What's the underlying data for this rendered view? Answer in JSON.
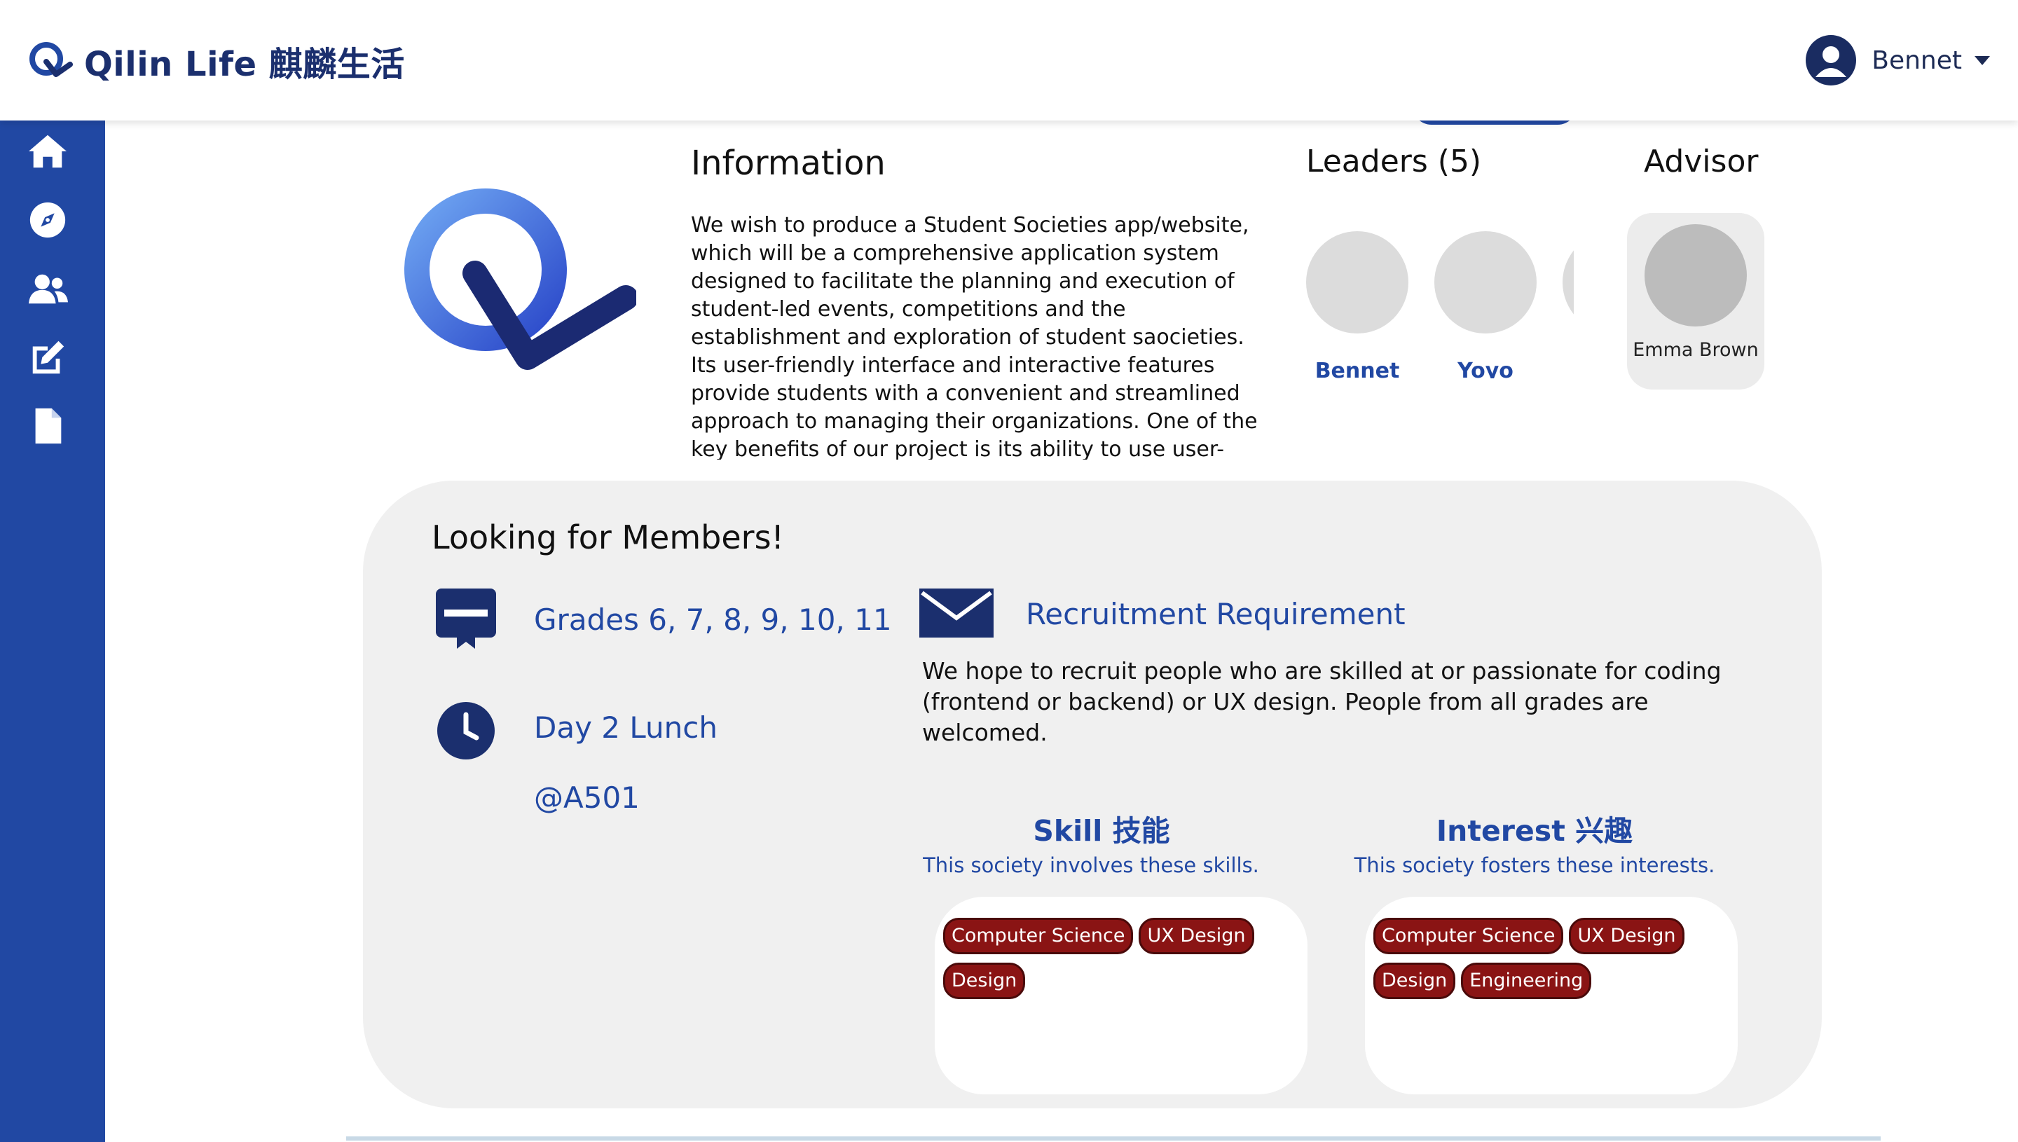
{
  "header": {
    "brand": "Qilin Life 麒麟生活",
    "user_name": "Bennet"
  },
  "sidebar": {
    "items": [
      {
        "icon": "home-icon"
      },
      {
        "icon": "compass-icon"
      },
      {
        "icon": "users-icon"
      },
      {
        "icon": "edit-icon"
      },
      {
        "icon": "document-icon"
      }
    ]
  },
  "information": {
    "title": "Information",
    "body": "We wish to produce a Student Societies app/website, which will be a comprehensive application system designed to facilitate the planning and execution of student-led events, competitions and the establishment and exploration of student saocieties. Its user-friendly interface and interactive features provide students with a convenient and streamlined approach to managing their organizations. One of the key benefits of our project is its ability to use user-experience design and computer"
  },
  "leaders": {
    "title": "Leaders (5)",
    "names": [
      "Bennet",
      "Yoyo"
    ]
  },
  "advisor": {
    "title": "Advisor",
    "name": "Emma Brown"
  },
  "recruit": {
    "title": "Looking for Members!",
    "grades": "Grades 6, 7, 8, 9, 10, 11",
    "time": "Day 2 Lunch",
    "location": "@A501",
    "requirement_title": "Recruitment Requirement",
    "requirement_body": "We hope to recruit people who are skilled at or passionate for coding (frontend or backend) or UX design. People from all grades are welcomed."
  },
  "skills": {
    "title": "Skill 技能",
    "subtitle": "This society involves these skills.",
    "tags": [
      "Computer Science",
      "UX Design",
      "Design"
    ]
  },
  "interests": {
    "title": "Interest 兴趣",
    "subtitle": "This society fosters these interests.",
    "tags": [
      "Computer Science",
      "UX Design",
      "Design",
      "Engineering"
    ]
  },
  "colors": {
    "primary": "#2148a3",
    "navy": "#1b2f6e",
    "tag": "#8a1414",
    "panel": "#f0f0f0"
  }
}
